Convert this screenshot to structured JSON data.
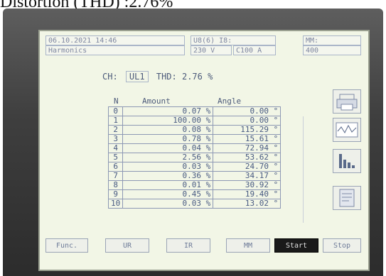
{
  "caption": "Distortion (THD) :2.76%",
  "header": {
    "datetime": "06.10.2021 14:46",
    "mode": "Harmonics",
    "volt_label": "U8(6) I8:",
    "volt_value": "230 V",
    "curr_value": "C100 A",
    "mm_label": "MM:",
    "mm_value": "400"
  },
  "channel": {
    "label": "CH:",
    "value": "UL1",
    "thd_label": "THD:",
    "thd_value": "2.76 %"
  },
  "table": {
    "headers": [
      "N",
      "Amount",
      "Angle"
    ],
    "rows": [
      [
        "0",
        "0.07 %",
        "0.00 °"
      ],
      [
        "1",
        "100.00 %",
        "0.00 °"
      ],
      [
        "2",
        "0.08 %",
        "115.29 °"
      ],
      [
        "3",
        "0.78 %",
        "15.61 °"
      ],
      [
        "4",
        "0.04 %",
        "72.94 °"
      ],
      [
        "5",
        "2.56 %",
        "53.62 °"
      ],
      [
        "6",
        "0.03 %",
        "24.70 °"
      ],
      [
        "7",
        "0.36 %",
        "34.17 °"
      ],
      [
        "8",
        "0.01 %",
        "30.92 °"
      ],
      [
        "9",
        "0.45 %",
        "19.40 °"
      ],
      [
        "10",
        "0.03 %",
        "13.02 °"
      ]
    ]
  },
  "sidebar_icons": [
    "printer-icon",
    "scope-icon",
    "bar-chart-icon",
    "memory-icon"
  ],
  "buttons": [
    {
      "label": "Func.",
      "active": false
    },
    {
      "label": "UR",
      "active": false
    },
    {
      "label": "IR",
      "active": false
    },
    {
      "label": "MM",
      "active": false
    },
    {
      "label": "Start",
      "active": true
    },
    {
      "label": "Stop",
      "active": false
    }
  ]
}
